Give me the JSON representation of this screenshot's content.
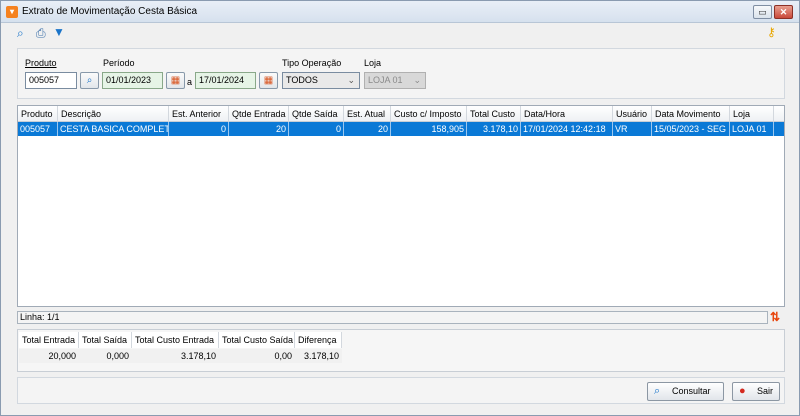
{
  "window": {
    "title": "Extrato de Movimentação Cesta Básica"
  },
  "icons": {
    "app": "app-icon",
    "search": "search-icon",
    "print": "print-icon",
    "filter": "filter-icon",
    "key": "key-icon",
    "calendar": "calendar-icon",
    "sort": "sort-icon",
    "consultar": "search-icon",
    "sair": "exit-icon"
  },
  "colors": {
    "selected_row": "#0a79d6",
    "filter_icon": "#1a74c9",
    "key_icon": "#e8a600",
    "sair_icon": "#d42a1f"
  },
  "filters": {
    "produto_label": "Produto",
    "produto_value": "005057",
    "periodo_label": "Período",
    "data_inicio": "01/01/2023",
    "separator": "a",
    "data_fim": "17/01/2024",
    "tipo_operacao_label": "Tipo Operação",
    "tipo_operacao_value": "TODOS",
    "loja_label": "Loja",
    "loja_value": "LOJA 01"
  },
  "grid": {
    "columns": [
      "Produto",
      "Descrição",
      "Est. Anterior",
      "Qtde Entrada",
      "Qtde Saída",
      "Est. Atual",
      "Custo c/ Imposto",
      "Total Custo",
      "Data/Hora",
      "Usuário",
      "Data Movimento",
      "Loja"
    ],
    "rows": [
      [
        "005057",
        "CESTA BASICA COMPLETA",
        "0",
        "20",
        "0",
        "20",
        "158,905",
        "3.178,10",
        "17/01/2024 12:42:18",
        "VR",
        "15/05/2023 - SEG",
        "LOJA 01"
      ]
    ]
  },
  "status": {
    "linha": "Linha: 1/1"
  },
  "totals": {
    "headers": [
      "Total Entrada",
      "Total Saída",
      "Total Custo Entrada",
      "Total Custo Saída",
      "Diferença"
    ],
    "values": [
      "20,000",
      "0,000",
      "3.178,10",
      "0,00",
      "3.178,10"
    ]
  },
  "buttons": {
    "consultar": "Consultar",
    "sair": "Sair"
  }
}
